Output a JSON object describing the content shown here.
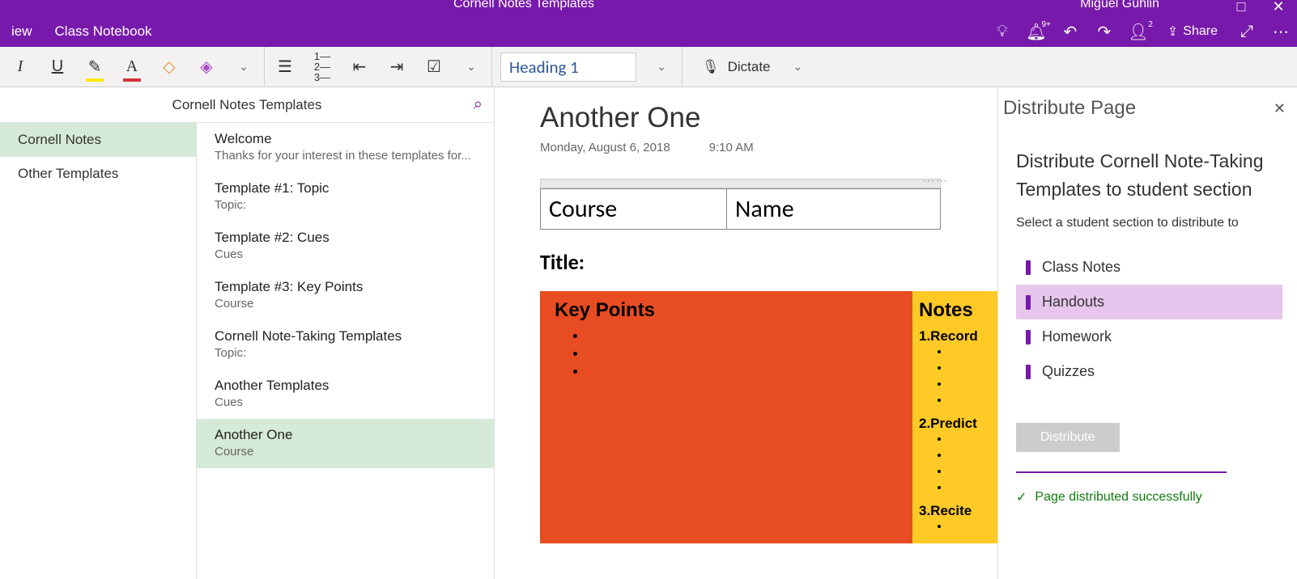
{
  "titlebar": {
    "doc_title": "Cornell Notes Templates",
    "user_name": "Miguel Guhlin"
  },
  "menubar": {
    "view": "iew",
    "class_notebook": "Class Notebook",
    "notif_badge": "9+",
    "share": "Share"
  },
  "ribbon": {
    "style": "Heading 1",
    "dictate": "Dictate"
  },
  "nav": {
    "title": "Cornell Notes Templates",
    "sections": [
      {
        "label": "Cornell Notes",
        "active": true
      },
      {
        "label": "Other Templates",
        "active": false
      }
    ],
    "pages": [
      {
        "title": "Welcome",
        "sub": "Thanks for your interest in these templates for...",
        "active": false
      },
      {
        "title": "Template #1: Topic",
        "sub": "Topic:",
        "active": false
      },
      {
        "title": "Template #2: Cues",
        "sub": "Cues",
        "active": false
      },
      {
        "title": "Template #3: Key Points",
        "sub": "Course",
        "active": false
      },
      {
        "title": "Cornell Note-Taking Templates",
        "sub": "Topic:",
        "active": false
      },
      {
        "title": "Another Templates",
        "sub": "Cues",
        "active": false
      },
      {
        "title": "Another One",
        "sub": "Course",
        "active": true
      }
    ]
  },
  "canvas": {
    "title": "Another One",
    "date": "Monday, August 6, 2018",
    "time": "9:10 AM",
    "course_label": "Course",
    "name_label": "Name",
    "title_label": "Title:",
    "kp_header": "Key Points",
    "notes_header": "Notes",
    "steps": [
      "1.Record",
      "2.Predict",
      "3.Recite"
    ]
  },
  "pane": {
    "header": "Distribute Page",
    "title": "Distribute Cornell Note-Taking Templates to student section",
    "sub": "Select a student section to distribute to",
    "sections": [
      {
        "label": "Class Notes",
        "selected": false
      },
      {
        "label": "Handouts",
        "selected": true
      },
      {
        "label": "Homework",
        "selected": false
      },
      {
        "label": "Quizzes",
        "selected": false
      }
    ],
    "button": "Distribute",
    "success": "Page distributed successfully"
  }
}
